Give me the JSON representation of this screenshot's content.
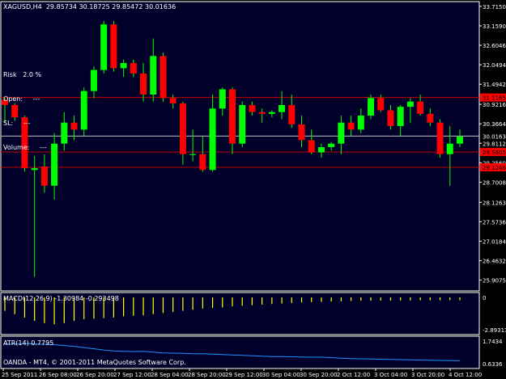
{
  "colors": {
    "background": "#000000",
    "plot_bg": "#00002a",
    "grid": "#ffffff",
    "bull": "#00ff00",
    "bear": "#ff0000",
    "wick": "#00ff00",
    "level_line": "#c00000",
    "current_line": "#c0c0c0",
    "macd": "#ffff00",
    "atr": "#1e90ff",
    "text": "#ffffff",
    "label_red_bg": "#ff0000"
  },
  "header": {
    "title": "XAGUSD,H4  29.85734 30.18725 29.85472 30.01636"
  },
  "risk_panel": {
    "lines": [
      "Risk   2.0 %",
      "Open:     ---",
      "SL:     ---",
      "Volume:     ---"
    ]
  },
  "macd_panel": {
    "label": "MACD(12,26,9) -1.30984 -0.293498"
  },
  "atr_panel": {
    "label": "ATR(14) 0.7795"
  },
  "copyright": "OANDA - MT4, © 2001-2011 MetaQuotes Software Corp.",
  "chart_data": {
    "type": "candlestick",
    "symbol": "XAGUSD",
    "timeframe": "H4",
    "ylim": [
      25.6,
      33.85
    ],
    "price_ticks": [
      "33.7150",
      "33.1590",
      "32.6046",
      "32.0494",
      "31.4942",
      "30.9216",
      "30.3664",
      "29.8112",
      "29.2560",
      "28.7008",
      "28.1263",
      "27.5736",
      "27.0184",
      "26.4632",
      "25.9075"
    ],
    "price_labels": [
      {
        "text": "30.0163",
        "price": 30.0163,
        "style": "current"
      },
      {
        "text": "31.1165",
        "price": 31.1165,
        "style": "red"
      },
      {
        "text": "29.5605",
        "price": 29.5605,
        "style": "red"
      },
      {
        "text": "29.1246",
        "price": 29.1246,
        "style": "red"
      }
    ],
    "level_lines": [
      31.1165,
      29.5605,
      29.1246
    ],
    "current_price": 30.0163,
    "time_labels": [
      "25 Sep 2011",
      "26 Sep 08:00",
      "26 Sep 20:00",
      "27 Sep 12:00",
      "28 Sep 04:00",
      "28 Sep 20:00",
      "29 Sep 12:00",
      "30 Sep 04:00",
      "30 Sep 20:00",
      "2 Oct 12:00",
      "3 Oct 04:00",
      "3 Oct 20:00",
      "4 Oct 12:00"
    ],
    "candles": [
      {
        "o": 31.05,
        "h": 31.1,
        "l": 30.4,
        "c": 30.9
      },
      {
        "o": 30.9,
        "h": 30.95,
        "l": 30.45,
        "c": 30.55
      },
      {
        "o": 30.55,
        "h": 30.6,
        "l": 29.0,
        "c": 29.1
      },
      {
        "o": 29.05,
        "h": 29.45,
        "l": 26.0,
        "c": 29.1
      },
      {
        "o": 29.15,
        "h": 29.5,
        "l": 28.4,
        "c": 28.6
      },
      {
        "o": 28.6,
        "h": 30.1,
        "l": 28.2,
        "c": 29.8
      },
      {
        "o": 29.8,
        "h": 30.7,
        "l": 29.6,
        "c": 30.4
      },
      {
        "o": 30.4,
        "h": 30.6,
        "l": 29.9,
        "c": 30.2
      },
      {
        "o": 30.2,
        "h": 31.4,
        "l": 30.0,
        "c": 31.3
      },
      {
        "o": 31.3,
        "h": 32.0,
        "l": 31.1,
        "c": 31.9
      },
      {
        "o": 31.9,
        "h": 33.3,
        "l": 31.8,
        "c": 33.2
      },
      {
        "o": 33.2,
        "h": 33.3,
        "l": 31.85,
        "c": 31.95
      },
      {
        "o": 31.95,
        "h": 32.2,
        "l": 31.7,
        "c": 32.1
      },
      {
        "o": 32.1,
        "h": 32.2,
        "l": 31.7,
        "c": 31.8
      },
      {
        "o": 31.8,
        "h": 32.1,
        "l": 31.0,
        "c": 31.2
      },
      {
        "o": 31.2,
        "h": 32.8,
        "l": 31.0,
        "c": 32.3
      },
      {
        "o": 32.3,
        "h": 32.4,
        "l": 31.0,
        "c": 31.1
      },
      {
        "o": 31.1,
        "h": 31.2,
        "l": 30.8,
        "c": 30.95
      },
      {
        "o": 30.95,
        "h": 31.0,
        "l": 29.2,
        "c": 29.5
      },
      {
        "o": 29.5,
        "h": 30.2,
        "l": 29.3,
        "c": 29.5
      },
      {
        "o": 29.5,
        "h": 30.0,
        "l": 29.0,
        "c": 29.05
      },
      {
        "o": 29.05,
        "h": 31.2,
        "l": 29.0,
        "c": 30.8
      },
      {
        "o": 30.8,
        "h": 31.4,
        "l": 30.6,
        "c": 31.35
      },
      {
        "o": 31.35,
        "h": 31.4,
        "l": 29.5,
        "c": 29.8
      },
      {
        "o": 29.8,
        "h": 31.0,
        "l": 29.7,
        "c": 30.9
      },
      {
        "o": 30.9,
        "h": 31.0,
        "l": 30.6,
        "c": 30.7
      },
      {
        "o": 30.7,
        "h": 30.8,
        "l": 30.4,
        "c": 30.65
      },
      {
        "o": 30.65,
        "h": 30.75,
        "l": 30.55,
        "c": 30.7
      },
      {
        "o": 30.7,
        "h": 31.3,
        "l": 30.5,
        "c": 30.9
      },
      {
        "o": 30.9,
        "h": 31.2,
        "l": 30.25,
        "c": 30.35
      },
      {
        "o": 30.35,
        "h": 30.6,
        "l": 29.7,
        "c": 29.9
      },
      {
        "o": 29.9,
        "h": 30.2,
        "l": 29.5,
        "c": 29.55
      },
      {
        "o": 29.55,
        "h": 29.8,
        "l": 29.4,
        "c": 29.7
      },
      {
        "o": 29.7,
        "h": 29.85,
        "l": 29.6,
        "c": 29.8
      },
      {
        "o": 29.8,
        "h": 30.6,
        "l": 29.5,
        "c": 30.4
      },
      {
        "o": 30.4,
        "h": 30.6,
        "l": 30.0,
        "c": 30.2
      },
      {
        "o": 30.2,
        "h": 30.8,
        "l": 30.1,
        "c": 30.6
      },
      {
        "o": 30.6,
        "h": 31.2,
        "l": 30.5,
        "c": 31.1
      },
      {
        "o": 31.1,
        "h": 31.2,
        "l": 30.7,
        "c": 30.75
      },
      {
        "o": 30.75,
        "h": 30.9,
        "l": 30.2,
        "c": 30.3
      },
      {
        "o": 30.3,
        "h": 30.9,
        "l": 30.0,
        "c": 30.85
      },
      {
        "o": 30.85,
        "h": 31.1,
        "l": 30.4,
        "c": 31.0
      },
      {
        "o": 31.0,
        "h": 31.2,
        "l": 30.6,
        "c": 30.65
      },
      {
        "o": 30.65,
        "h": 30.8,
        "l": 30.3,
        "c": 30.4
      },
      {
        "o": 30.4,
        "h": 30.5,
        "l": 29.4,
        "c": 29.5
      },
      {
        "o": 29.5,
        "h": 30.3,
        "l": 28.6,
        "c": 29.8
      },
      {
        "o": 29.8,
        "h": 30.2,
        "l": 29.7,
        "c": 30.0
      }
    ],
    "macd": {
      "range": [
        -2.89313,
        0
      ],
      "tick_labels": [
        "0",
        "-2.89313"
      ],
      "values": [
        -1.2,
        -1.5,
        -1.8,
        -2.1,
        -2.3,
        -2.4,
        -2.3,
        -2.1,
        -1.95,
        -1.9,
        -1.85,
        -1.8,
        -1.7,
        -1.65,
        -1.6,
        -1.5,
        -1.4,
        -1.3,
        -1.2,
        -1.1,
        -1.0,
        -0.95,
        -0.9,
        -0.8,
        -0.75,
        -0.7,
        -0.65,
        -0.6,
        -0.55,
        -0.5,
        -0.45,
        -0.42,
        -0.4,
        -0.37,
        -0.35,
        -0.32,
        -0.3,
        -0.3,
        -0.28,
        -0.28,
        -0.27,
        -0.27,
        -0.26,
        -0.26,
        -0.25,
        -0.25,
        -0.25
      ]
    },
    "atr": {
      "range": [
        0.6336,
        1.7434
      ],
      "tick_labels": [
        "1.7434",
        "0.6336"
      ],
      "values": [
        1.58,
        1.6,
        1.62,
        1.6,
        1.58,
        1.56,
        1.52,
        1.48,
        1.42,
        1.36,
        1.3,
        1.26,
        1.24,
        1.23,
        1.24,
        1.2,
        1.16,
        1.15,
        1.14,
        1.12,
        1.12,
        1.1,
        1.08,
        1.06,
        1.04,
        1.02,
        1.0,
        0.98,
        0.98,
        0.97,
        0.96,
        0.95,
        0.95,
        0.93,
        0.9,
        0.88,
        0.87,
        0.86,
        0.85,
        0.84,
        0.83,
        0.82,
        0.81,
        0.8,
        0.79,
        0.78,
        0.7795
      ]
    }
  }
}
